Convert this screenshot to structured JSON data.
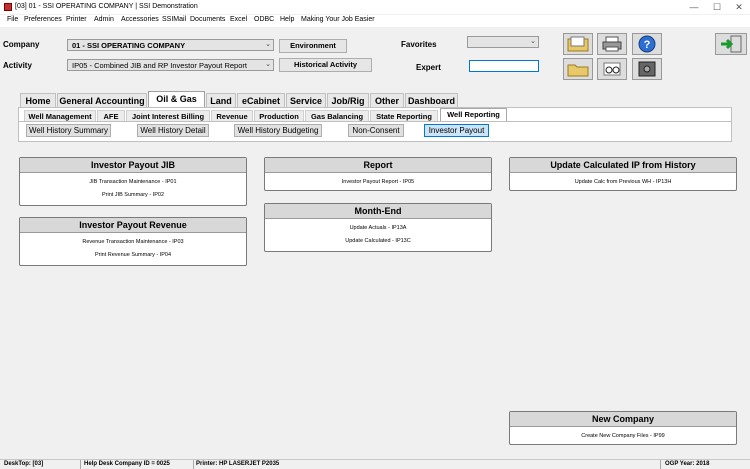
{
  "window": {
    "title": "[03]  01 - SSI OPERATING COMPANY | SSI Demonstration",
    "minimize": "—",
    "maximize": "☐",
    "close": "✕"
  },
  "menu": [
    "File",
    "Preferences",
    "Printer",
    "Admin",
    "Accessories",
    "SSIMail",
    "Documents",
    "Excel",
    "ODBC",
    "Help",
    "Making Your Job Easier"
  ],
  "form": {
    "company_label": "Company",
    "company_value": "01 - SSI OPERATING COMPANY",
    "environment_button": "Environment",
    "activity_label": "Activity",
    "activity_value": "IP05 - Combined JIB and RP Investor Payout Report",
    "historical_button": "Historical Activity",
    "favorites_label": "Favorites",
    "favorites_value": "",
    "expert_label": "Expert",
    "expert_value": ""
  },
  "tabs": [
    "Home",
    "General Accounting",
    "Oil & Gas",
    "Land",
    "eCabinet",
    "Service",
    "Job/Rig",
    "Other",
    "Dashboard"
  ],
  "active_tab": "Oil & Gas",
  "subtabs": [
    "Well Management",
    "AFE",
    "Joint Interest Billing",
    "Revenue",
    "Production",
    "Gas Balancing",
    "State Reporting",
    "Well Reporting"
  ],
  "active_subtab": "Well Reporting",
  "subbuttons": [
    "Well History Summary",
    "Well History Detail",
    "Well History Budgeting",
    "Non-Consent",
    "Investor Payout"
  ],
  "active_subbutton": "Investor Payout",
  "panels": {
    "jib": {
      "title": "Investor Payout JIB",
      "links": [
        "JIB Transaction Maintenance - IP01",
        "Print JIB Summary - IP02"
      ]
    },
    "revenue": {
      "title": "Investor Payout Revenue",
      "links": [
        "Revenue Transaction Maintenance - IP03",
        "Print Revenue Summary - IP04"
      ]
    },
    "report": {
      "title": "Report",
      "links": [
        "Investor Payout Report - IP05"
      ]
    },
    "monthend": {
      "title": "Month-End",
      "links": [
        "Update Actuals - IP13A",
        "Update Calculated - IP13C"
      ]
    },
    "update": {
      "title": "Update Calculated IP from History",
      "links": [
        "Update Calc from Previous WH - IP13H"
      ]
    },
    "newco": {
      "title": "New Company",
      "links": [
        "Create New Company Files - IP99"
      ]
    }
  },
  "status": {
    "desktop": "DeskTop:   [03]",
    "helpdesk": "Help Desk Company ID = 0025",
    "printer": "Printer: HP LASERJET P2035",
    "ogp": "OGP Year:   2018"
  },
  "colors": {
    "accent": "#0078d7",
    "panel_header": "#d8d8d8"
  }
}
